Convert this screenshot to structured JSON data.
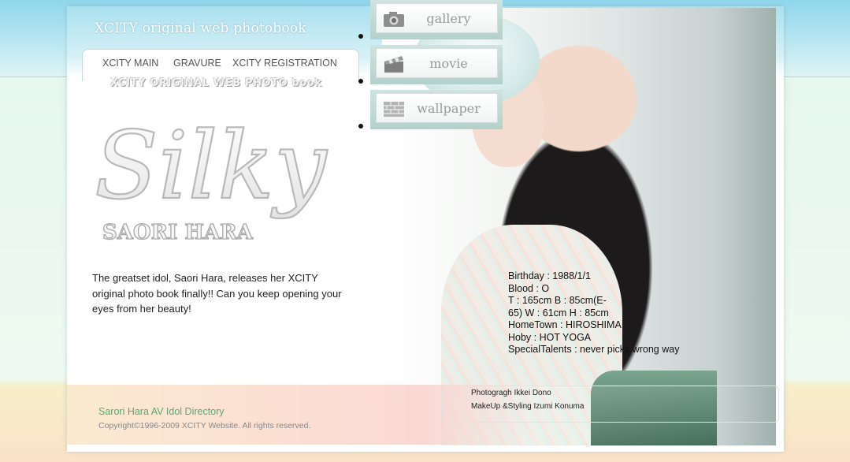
{
  "header": {
    "site_title": "XCITY original web photobook",
    "subtitle": "XCITY ORIGINAL WEB PHOTO book"
  },
  "tabs": [
    {
      "label": "XCITY MAIN"
    },
    {
      "label": "GRAVURE"
    },
    {
      "label": "XCITY REGISTRATION"
    }
  ],
  "logo": {
    "title": "Silky",
    "name": "SAORI HARA"
  },
  "nav": [
    {
      "label": "gallery",
      "icon": "camera-icon"
    },
    {
      "label": "movie",
      "icon": "film-clapper-icon"
    },
    {
      "label": "wallpaper",
      "icon": "brick-wall-icon"
    }
  ],
  "intro": {
    "text": "The greatset idol, Saori Hara, releases her XCITY original photo book finally!! Can you keep opening your eyes from her beauty!"
  },
  "profile": {
    "birthday": "Birthday : 1988/1/1",
    "blood": "Blood : O",
    "measurements_1": "T : 165cm B : 85cm(E-",
    "measurements_2": "65) W : 61cm H : 85cm",
    "hometown": "HomeTown : HIROSHIMA",
    "hobby": "Hoby : HOT YOGA",
    "talents": "SpecialTalents : never picks wrong way"
  },
  "credits": {
    "photograph": "Photogragh  Ikkei Dono",
    "makeup": "MakeUp &Styling  Izumi Konuma"
  },
  "footer": {
    "directory_link": "Sarori Hara AV Idol Directory",
    "copyright": "Copyright©1996-2009 XCITY Website. All rights reserved."
  }
}
